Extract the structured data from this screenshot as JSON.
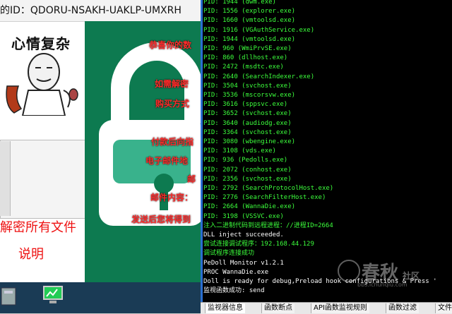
{
  "ransom": {
    "id_label": "的ID：QDORU-NSAKH-UAKLP-UMXRH",
    "meme_caption": "心情复杂",
    "decrypt_all": "解密所有文件",
    "instructions": "说明",
    "lock_lines": [
      "恭喜你的数",
      "如需解密",
      "购买方式",
      "付款后向指",
      "电子邮件地",
      "邮",
      "邮件内容：",
      "发送后您将得到"
    ]
  },
  "console": {
    "lines": [
      {
        "text": "PID: 1944 (dwm.exe)",
        "color": "#3cff3c"
      },
      {
        "text": "PID: 1556 (explorer.exe)",
        "color": "#3cff3c"
      },
      {
        "text": "PID: 1660 (vmtoolsd.exe)",
        "color": "#3cff3c"
      },
      {
        "text": "PID: 1916 (VGAuthService.exe)",
        "color": "#3cff3c"
      },
      {
        "text": "PID: 1944 (vmtoolsd.exe)",
        "color": "#3cff3c"
      },
      {
        "text": "PID: 960 (WmiPrvSE.exe)",
        "color": "#3cff3c"
      },
      {
        "text": "PID: 860 (dllhost.exe)",
        "color": "#3cff3c"
      },
      {
        "text": "PID: 2472 (msdtc.exe)",
        "color": "#3cff3c"
      },
      {
        "text": "PID: 2640 (SearchIndexer.exe)",
        "color": "#3cff3c"
      },
      {
        "text": "PID: 3504 (svchost.exe)",
        "color": "#3cff3c"
      },
      {
        "text": "PID: 3536 (mscorsvw.exe)",
        "color": "#3cff3c"
      },
      {
        "text": "PID: 3616 (sppsvc.exe)",
        "color": "#3cff3c"
      },
      {
        "text": "PID: 3652 (svchost.exe)",
        "color": "#3cff3c"
      },
      {
        "text": "PID: 3640 (audiodg.exe)",
        "color": "#3cff3c"
      },
      {
        "text": "PID: 3364 (svchost.exe)",
        "color": "#3cff3c"
      },
      {
        "text": "PID: 3080 (wbengine.exe)",
        "color": "#3cff3c"
      },
      {
        "text": "PID: 3108 (vds.exe)",
        "color": "#3cff3c"
      },
      {
        "text": "PID: 936 (Pedolls.exe)",
        "color": "#3cff3c"
      },
      {
        "text": "PID: 2072 (conhost.exe)",
        "color": "#3cff3c"
      },
      {
        "text": "PID: 2356 (svchost.exe)",
        "color": "#3cff3c"
      },
      {
        "text": "PID: 2792 (SearchProtocolHost.exe)",
        "color": "#3cff3c"
      },
      {
        "text": "PID: 2776 (SearchFilterHost.exe)",
        "color": "#3cff3c"
      },
      {
        "text": "PID: 2664 (WannaDie.exe)",
        "color": "#3cff3c"
      },
      {
        "text": "PID: 3198 (VSSVC.exe)",
        "color": "#3cff3c"
      },
      {
        "text": "注入二进制代码到远程进程：//进程ID=2664",
        "color": "#3cff3c"
      },
      {
        "text": "DLL inject succeeded.",
        "color": "#ffffff"
      },
      {
        "text": "尝试连接调试程序：192.168.44.129",
        "color": "#3cff3c"
      },
      {
        "text": "调试程序连接成功",
        "color": "#3cff3c"
      },
      {
        "text": "PeDoll Monitor v1.2.1",
        "color": "#ffffff"
      },
      {
        "text": "PROC WannaDie.exe",
        "color": "#ffffff"
      },
      {
        "text": "Doll is ready for debug,Preload hook configurations & Press '",
        "color": "#ffffff"
      },
      {
        "text": "监视函数成功: send",
        "color": "#ffffff"
      }
    ]
  },
  "watermark": {
    "text": "春秋",
    "suffix": "社区",
    "sub": "bbs.ichunqiu.com"
  },
  "tabs": [
    "监视器信息",
    "函数断点",
    "API函数监视规则",
    "函数过滤",
    "文件"
  ]
}
